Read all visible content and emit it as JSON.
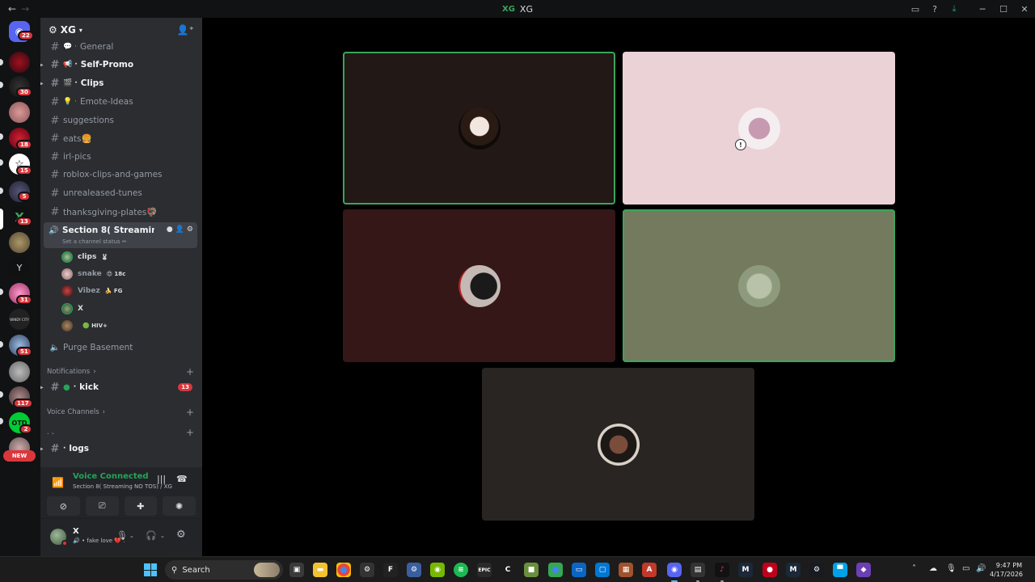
{
  "titlebar": {
    "back": "←",
    "forward": "→",
    "logo": "XG",
    "title": "XG"
  },
  "server_rail": {
    "badges": [
      "22",
      "30",
      "18",
      "15",
      "5",
      "13",
      "31",
      "51",
      "117",
      "2"
    ],
    "text_icons": {
      "y": "Y",
      "otd": "OTD",
      "winter": "WINDY CITY"
    },
    "new_label": "NEW"
  },
  "sidebar": {
    "server_name": "XG",
    "channels": [
      {
        "name": "General",
        "emoji": "💬 ·",
        "bold": false
      },
      {
        "name": "Self-Promo",
        "emoji": "📢 ·",
        "bold": true
      },
      {
        "name": "Clips",
        "emoji": "🎬 ·",
        "bold": true
      },
      {
        "name": "Emote-Ideas",
        "emoji": "💡 ·",
        "bold": false
      },
      {
        "name": "suggestions",
        "emoji": "",
        "bold": false
      },
      {
        "name": "eats🍔",
        "emoji": "",
        "bold": false
      },
      {
        "name": "irl-pics",
        "emoji": "",
        "bold": false
      },
      {
        "name": "roblox-clips-and-games",
        "emoji": "",
        "bold": false
      },
      {
        "name": "unrealeased-tunes",
        "emoji": "",
        "bold": false
      },
      {
        "name": "thanksgiving-plates🦃",
        "emoji": "",
        "bold": false
      }
    ],
    "voice_channel": {
      "name": "Section 8( Streaming N...",
      "status": "Set a channel status ✏"
    },
    "members": [
      {
        "name": "clips",
        "tag": "🐰"
      },
      {
        "name": "snake",
        "tag": "😍 18c"
      },
      {
        "name": "Vibez",
        "tag": "🍌 FG"
      },
      {
        "name": "X",
        "tag": ""
      },
      {
        "name": "",
        "tag": "🟢 HIV+"
      }
    ],
    "purge_channel": "Purge Basement",
    "categories": {
      "notifications": "Notifications",
      "voice_channels": "Voice Channels",
      "blank": "."
    },
    "kick_channel": {
      "name": "kick",
      "mention": "13"
    },
    "logs_channel": "logs"
  },
  "voice_panel": {
    "connected_label": "Voice Connected",
    "channel_path": "Section 8( Streaming NO TOS) / XG"
  },
  "user_panel": {
    "username": "X",
    "status": "🔊 • fake love 💔 ."
  },
  "taskbar": {
    "search_label": "Search",
    "time": "9:47 PM",
    "date": "4/17/2026"
  },
  "colors": {
    "speaking": "#3ba55c",
    "tile_1": "#221816",
    "tile_2": "#ead2d6",
    "tile_3": "#351718",
    "tile_4": "#737a5e",
    "tile_5": "#292522"
  }
}
